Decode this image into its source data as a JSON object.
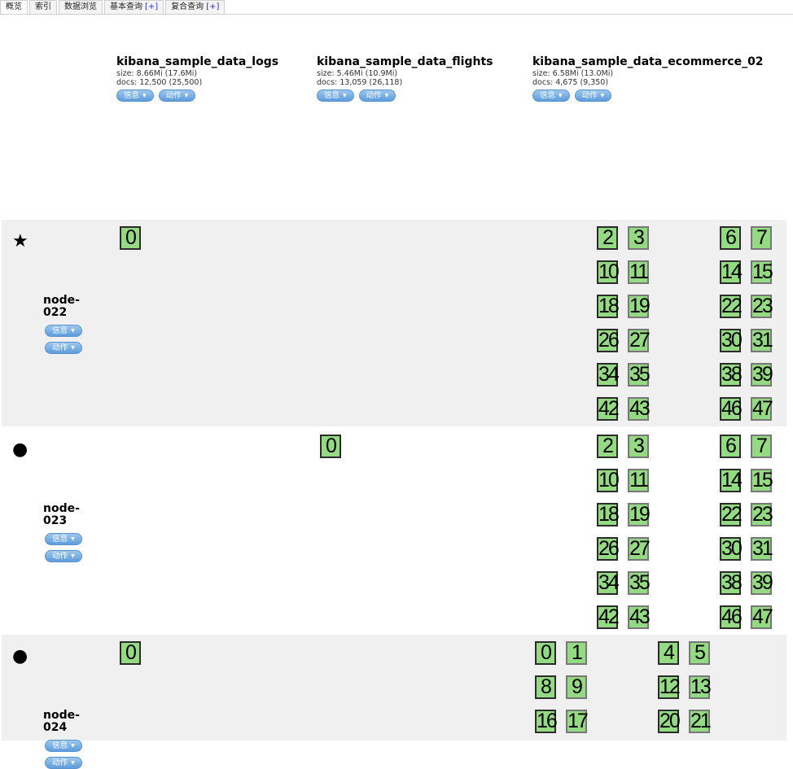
{
  "tabs": [
    {
      "label": "概览",
      "plus": ""
    },
    {
      "label": "索引",
      "plus": ""
    },
    {
      "label": "数据浏览",
      "plus": ""
    },
    {
      "label": "基本查询",
      "plus": "[+]"
    },
    {
      "label": "复合查询",
      "plus": "[+]"
    }
  ],
  "indices": [
    {
      "name": "kibana_sample_data_logs",
      "size": "size: 8.66Mi (17.6Mi)",
      "docs": "docs: 12,500 (25,500)",
      "info_label": "信息",
      "action_label": "动作"
    },
    {
      "name": "kibana_sample_data_flights",
      "size": "size: 5.46Mi (10.9Mi)",
      "docs": "docs: 13,059 (26,118)",
      "info_label": "信息",
      "action_label": "动作"
    },
    {
      "name": "kibana_sample_data_ecommerce_02",
      "size": "size: 6.58Mi (13.0Mi)",
      "docs": "docs: 4,675 (9,350)",
      "info_label": "信息",
      "action_label": "动作"
    }
  ],
  "nodes": [
    {
      "marker": "★",
      "name_line1": "node-",
      "name_line2": "022",
      "info_label": "信息",
      "action_label": "动作"
    },
    {
      "marker": "●",
      "name_line1": "node-",
      "name_line2": "023",
      "info_label": "信息",
      "action_label": "动作"
    },
    {
      "marker": "●",
      "name_line1": "node-",
      "name_line2": "024",
      "info_label": "信息",
      "action_label": "动作"
    }
  ],
  "node_shards": [
    {
      "logs": [
        "0"
      ],
      "flights": [],
      "ecommerce": [
        "2",
        "3",
        "6",
        "7",
        "10",
        "11",
        "14",
        "15",
        "18",
        "19",
        "22",
        "23",
        "26",
        "27",
        "30",
        "31",
        "34",
        "35",
        "38",
        "39",
        "42",
        "43",
        "46",
        "47"
      ]
    },
    {
      "logs": [],
      "flights": [
        "0"
      ],
      "ecommerce": [
        "2",
        "3",
        "6",
        "7",
        "10",
        "11",
        "14",
        "15",
        "18",
        "19",
        "22",
        "23",
        "26",
        "27",
        "30",
        "31",
        "34",
        "35",
        "38",
        "39",
        "42",
        "43",
        "46",
        "47"
      ]
    },
    {
      "logs": [
        "0"
      ],
      "flights": [],
      "ecommerce": [
        "0",
        "1",
        "4",
        "5",
        "8",
        "9",
        "12",
        "13",
        "16",
        "17",
        "20",
        "21"
      ]
    }
  ],
  "colors": {
    "shard_fill": "#93da83",
    "button": "#6aa6e0",
    "row_shade": "#f0f0f0"
  }
}
